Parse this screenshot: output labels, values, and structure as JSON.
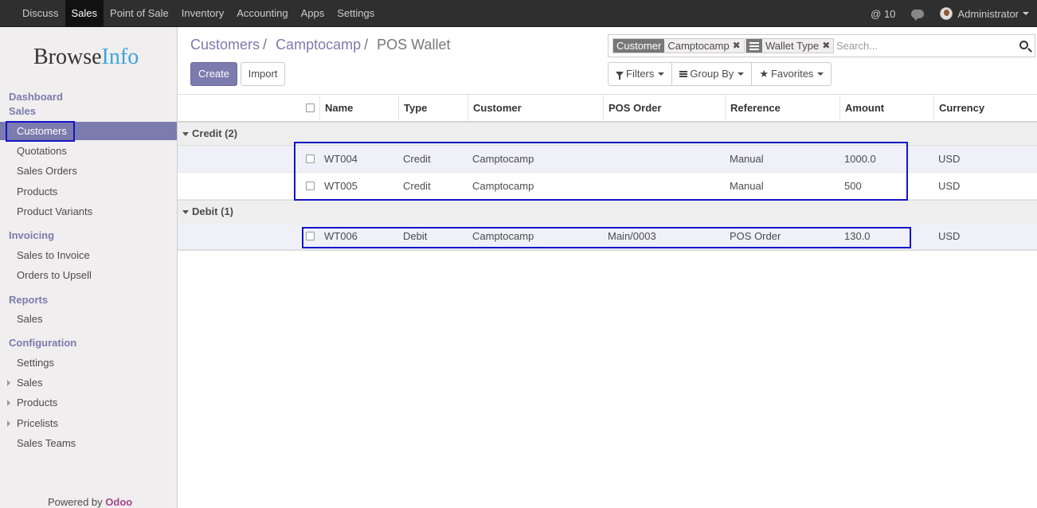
{
  "topbar": {
    "menu": [
      "Discuss",
      "Sales",
      "Point of Sale",
      "Inventory",
      "Accounting",
      "Apps",
      "Settings"
    ],
    "active_menu": "Sales",
    "mentions": "@ 10",
    "user": "Administrator"
  },
  "sidebar": {
    "logo_a": "Browse",
    "logo_b": "Info",
    "sections": {
      "dashboard": "Dashboard",
      "sales": "Sales",
      "invoicing": "Invoicing",
      "reports": "Reports",
      "configuration": "Configuration"
    },
    "sales_items": [
      "Customers",
      "Quotations",
      "Sales Orders",
      "Products",
      "Product Variants"
    ],
    "invoicing_items": [
      "Sales to Invoice",
      "Orders to Upsell"
    ],
    "reports_items": [
      "Sales"
    ],
    "config_items": [
      "Settings",
      "Sales",
      "Products",
      "Pricelists",
      "Sales Teams"
    ],
    "powered_by": "Powered by",
    "powered_brand": "Odoo"
  },
  "breadcrumb": {
    "items": [
      "Customers",
      "Camptocamp",
      "POS Wallet"
    ],
    "separator": "/"
  },
  "buttons": {
    "create": "Create",
    "import": "Import"
  },
  "search": {
    "facet1_category": "Customer",
    "facet1_value": "Camptocamp",
    "facet2_value": "Wallet Type",
    "placeholder": "Search..."
  },
  "toolbar": {
    "filters": "Filters",
    "group_by": "Group By",
    "favorites": "Favorites"
  },
  "table": {
    "columns": [
      "Name",
      "Type",
      "Customer",
      "POS Order",
      "Reference",
      "Amount",
      "Currency"
    ],
    "groups": [
      {
        "label": "Credit (2)",
        "rows": [
          {
            "name": "WT004",
            "type": "Credit",
            "customer": "Camptocamp",
            "pos_order": "",
            "reference": "Manual",
            "amount": "1000.0",
            "currency": "USD"
          },
          {
            "name": "WT005",
            "type": "Credit",
            "customer": "Camptocamp",
            "pos_order": "",
            "reference": "Manual",
            "amount": "500",
            "currency": "USD"
          }
        ]
      },
      {
        "label": "Debit (1)",
        "rows": [
          {
            "name": "WT006",
            "type": "Debit",
            "customer": "Camptocamp",
            "pos_order": "Main/0003",
            "reference": "POS Order",
            "amount": "130.0",
            "currency": "USD"
          }
        ]
      }
    ]
  },
  "colors": {
    "accent": "#7c7bad",
    "navbar": "#2f2f2f",
    "highlight": "#1414c8"
  }
}
